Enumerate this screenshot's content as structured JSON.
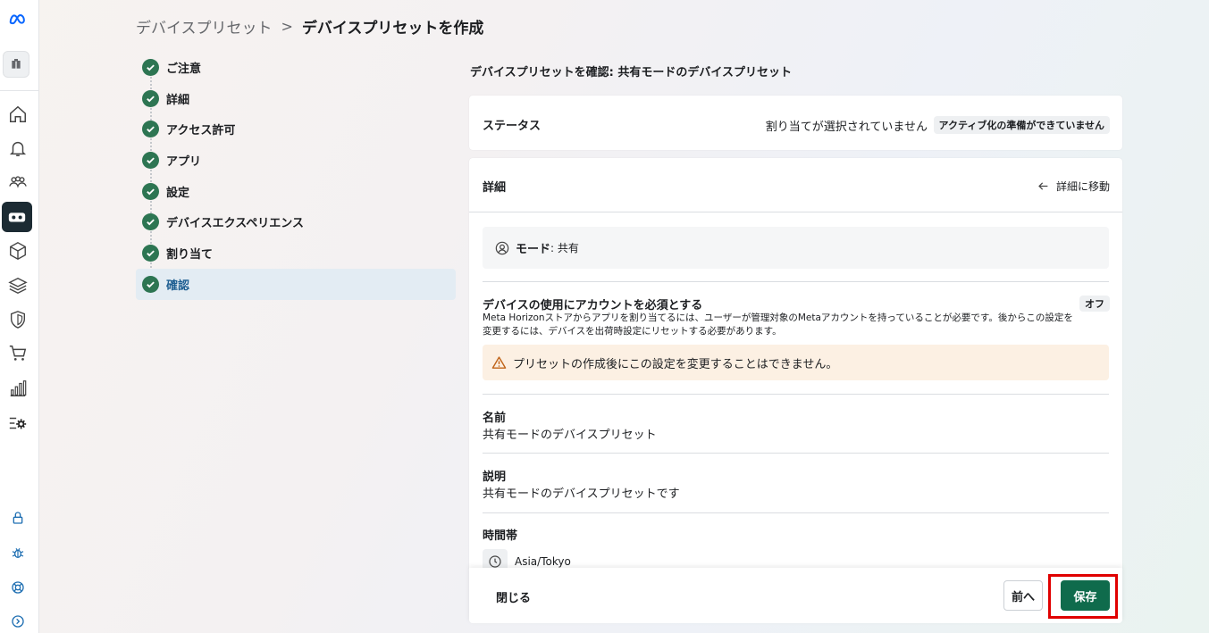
{
  "breadcrumb": {
    "parent": "デバイスプリセット",
    "separator": ">",
    "current": "デバイスプリセットを作成"
  },
  "steps": [
    {
      "label": "ご注意"
    },
    {
      "label": "詳細"
    },
    {
      "label": "アクセス許可"
    },
    {
      "label": "アプリ"
    },
    {
      "label": "設定"
    },
    {
      "label": "デバイスエクスペリエンス"
    },
    {
      "label": "割り当て"
    },
    {
      "label": "確認",
      "active": true
    }
  ],
  "main": {
    "heading": "デバイスプリセットを確認: 共有モードのデバイスプリセット",
    "status": {
      "label": "ステータス",
      "text": "割り当てが選択されていません",
      "badge": "アクティブ化の準備ができていません"
    },
    "details": {
      "title": "詳細",
      "link": "詳細に移動",
      "mode_key": "モード",
      "mode_value": ": 共有",
      "account_required_title": "デバイスの使用にアカウントを必須とする",
      "account_required_value": "オフ",
      "account_required_desc": "Meta Horizonストアからアプリを割り当てるには、ユーザーが管理対象のMetaアカウントを持っていることが必要です。後からこの設定を変更するには、デバイスを出荷時設定にリセットする必要があります。",
      "warning": "プリセットの作成後にこの設定を変更することはできません。",
      "name_title": "名前",
      "name_value": "共有モードのデバイスプリセット",
      "description_title": "説明",
      "description_value": "共有モードのデバイスプリセットです",
      "timezone_title": "時間帯",
      "timezone_value": "Asia/Tokyo"
    }
  },
  "footer": {
    "close": "閉じる",
    "prev": "前へ",
    "save": "保存"
  },
  "colors": {
    "accent_green": "#0f6b4c",
    "check_green": "#2d7552",
    "highlight_red": "#e00000",
    "active_step_bg": "#e3ecf3",
    "warning_bg": "#fcf0e3"
  }
}
